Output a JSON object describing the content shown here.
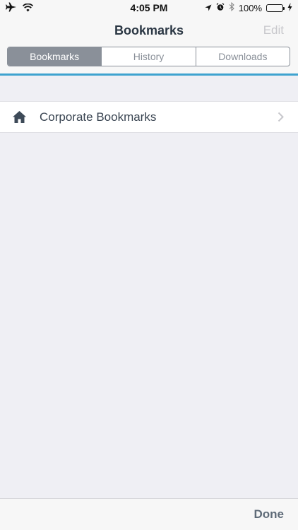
{
  "status_bar": {
    "time": "4:05 PM",
    "battery_label": "100%",
    "battery_level": 1.0,
    "battery_color": "#4cd964",
    "icons": [
      "airplane-icon",
      "wifi-icon",
      "location-arrow-icon",
      "alarm-icon",
      "bluetooth-icon",
      "battery-icon",
      "charging-bolt-icon"
    ]
  },
  "nav": {
    "title": "Bookmarks",
    "edit_label": "Edit"
  },
  "segments": [
    {
      "label": "Bookmarks",
      "active": true
    },
    {
      "label": "History",
      "active": false
    },
    {
      "label": "Downloads",
      "active": false
    }
  ],
  "accent_color": "#3fa3cf",
  "bookmarks": [
    {
      "label": "Corporate Bookmarks",
      "icon": "home-icon"
    }
  ],
  "toolbar": {
    "done_label": "Done"
  }
}
